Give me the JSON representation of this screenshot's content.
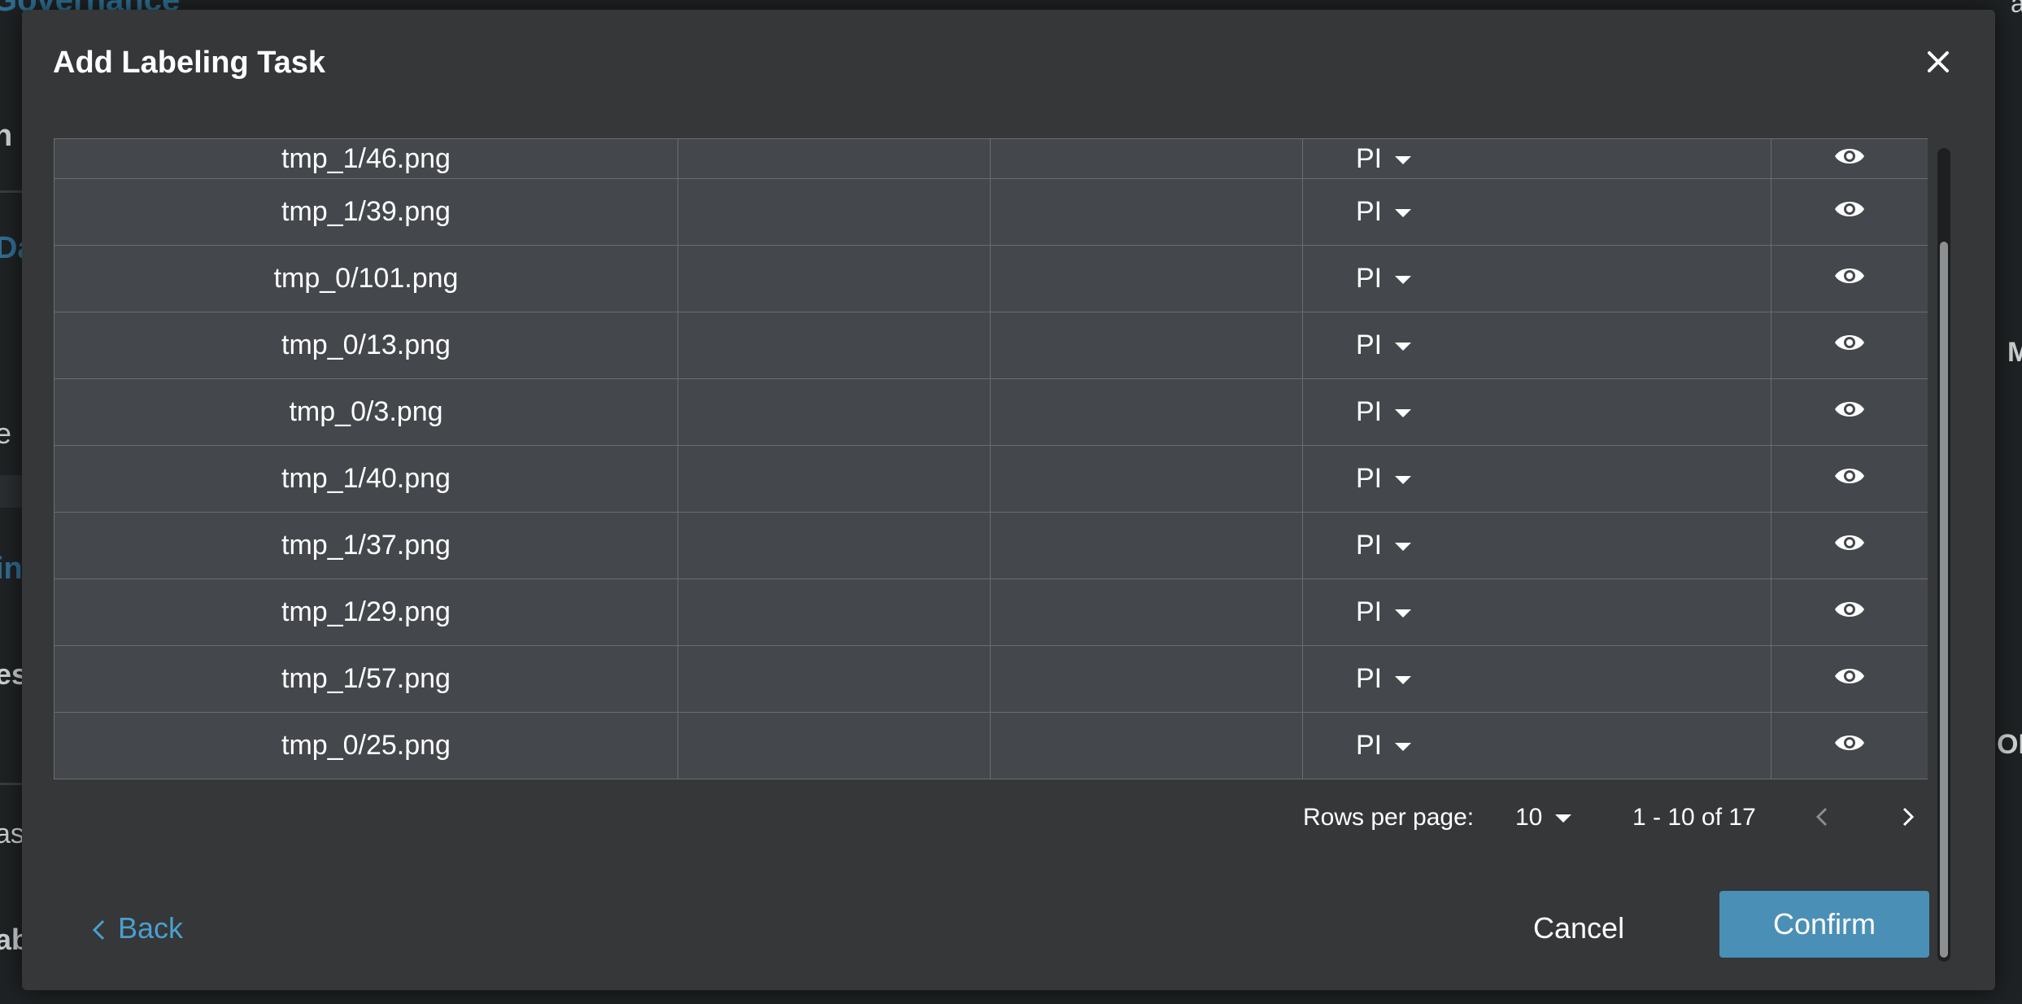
{
  "background": {
    "top_title": "Governance",
    "fragments": [
      "n",
      "Da",
      "e",
      "in",
      "es",
      "as",
      "ab",
      "M",
      "OM",
      "alte"
    ]
  },
  "dialog": {
    "title": "Add Labeling Task",
    "close_icon": "close-icon"
  },
  "table": {
    "rows": [
      {
        "file": "tmp_1/46.png",
        "label": "PI"
      },
      {
        "file": "tmp_1/39.png",
        "label": "PI"
      },
      {
        "file": "tmp_0/101.png",
        "label": "PI"
      },
      {
        "file": "tmp_0/13.png",
        "label": "PI"
      },
      {
        "file": "tmp_0/3.png",
        "label": "PI"
      },
      {
        "file": "tmp_1/40.png",
        "label": "PI"
      },
      {
        "file": "tmp_1/37.png",
        "label": "PI"
      },
      {
        "file": "tmp_1/29.png",
        "label": "PI"
      },
      {
        "file": "tmp_1/57.png",
        "label": "PI"
      },
      {
        "file": "tmp_0/25.png",
        "label": "PI"
      }
    ]
  },
  "pagination": {
    "rows_per_page_label": "Rows per page:",
    "rows_per_page_value": "10",
    "range": "1 - 10 of 17"
  },
  "footer": {
    "back_label": "Back",
    "cancel_label": "Cancel",
    "confirm_label": "Confirm"
  }
}
